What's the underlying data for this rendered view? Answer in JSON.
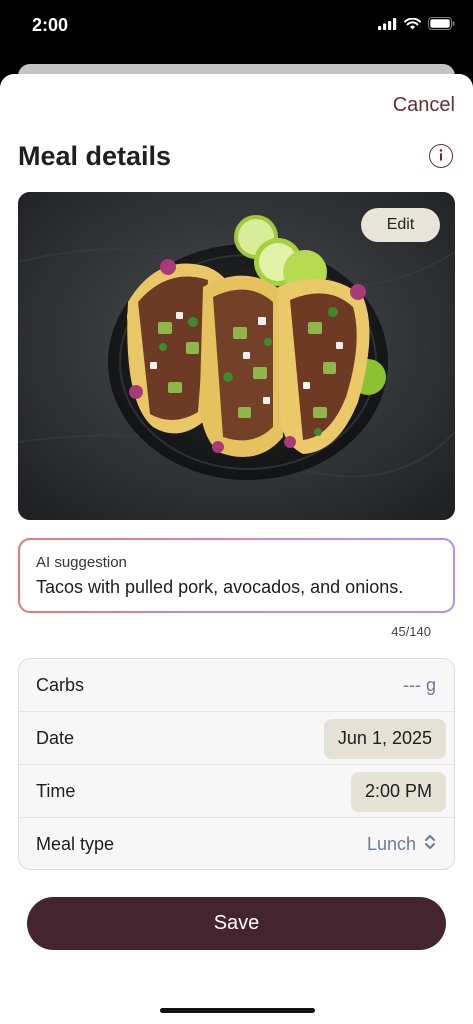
{
  "status_bar": {
    "time": "2:00",
    "icons": [
      "cellular-signal-icon",
      "wifi-icon",
      "battery-icon"
    ]
  },
  "header": {
    "cancel_label": "Cancel",
    "title": "Meal details",
    "info_icon": "info-icon"
  },
  "photo": {
    "edit_label": "Edit"
  },
  "ai_suggestion": {
    "label": "AI suggestion",
    "text": "Tacos with pulled pork, avocados, and onions.",
    "char_count": "45/140"
  },
  "details": {
    "carbs": {
      "label": "Carbs",
      "value": "--- g"
    },
    "date": {
      "label": "Date",
      "value": "Jun 1, 2025"
    },
    "time": {
      "label": "Time",
      "value": "2:00 PM"
    },
    "meal_type": {
      "label": "Meal type",
      "value": "Lunch",
      "icon": "chevron-up-down-icon"
    }
  },
  "save_label": "Save",
  "colors": {
    "accent": "#6b2b33",
    "save_button": "#43242f",
    "pill_background": "#e6e1d5",
    "secondary_value": "#6a7d92"
  }
}
